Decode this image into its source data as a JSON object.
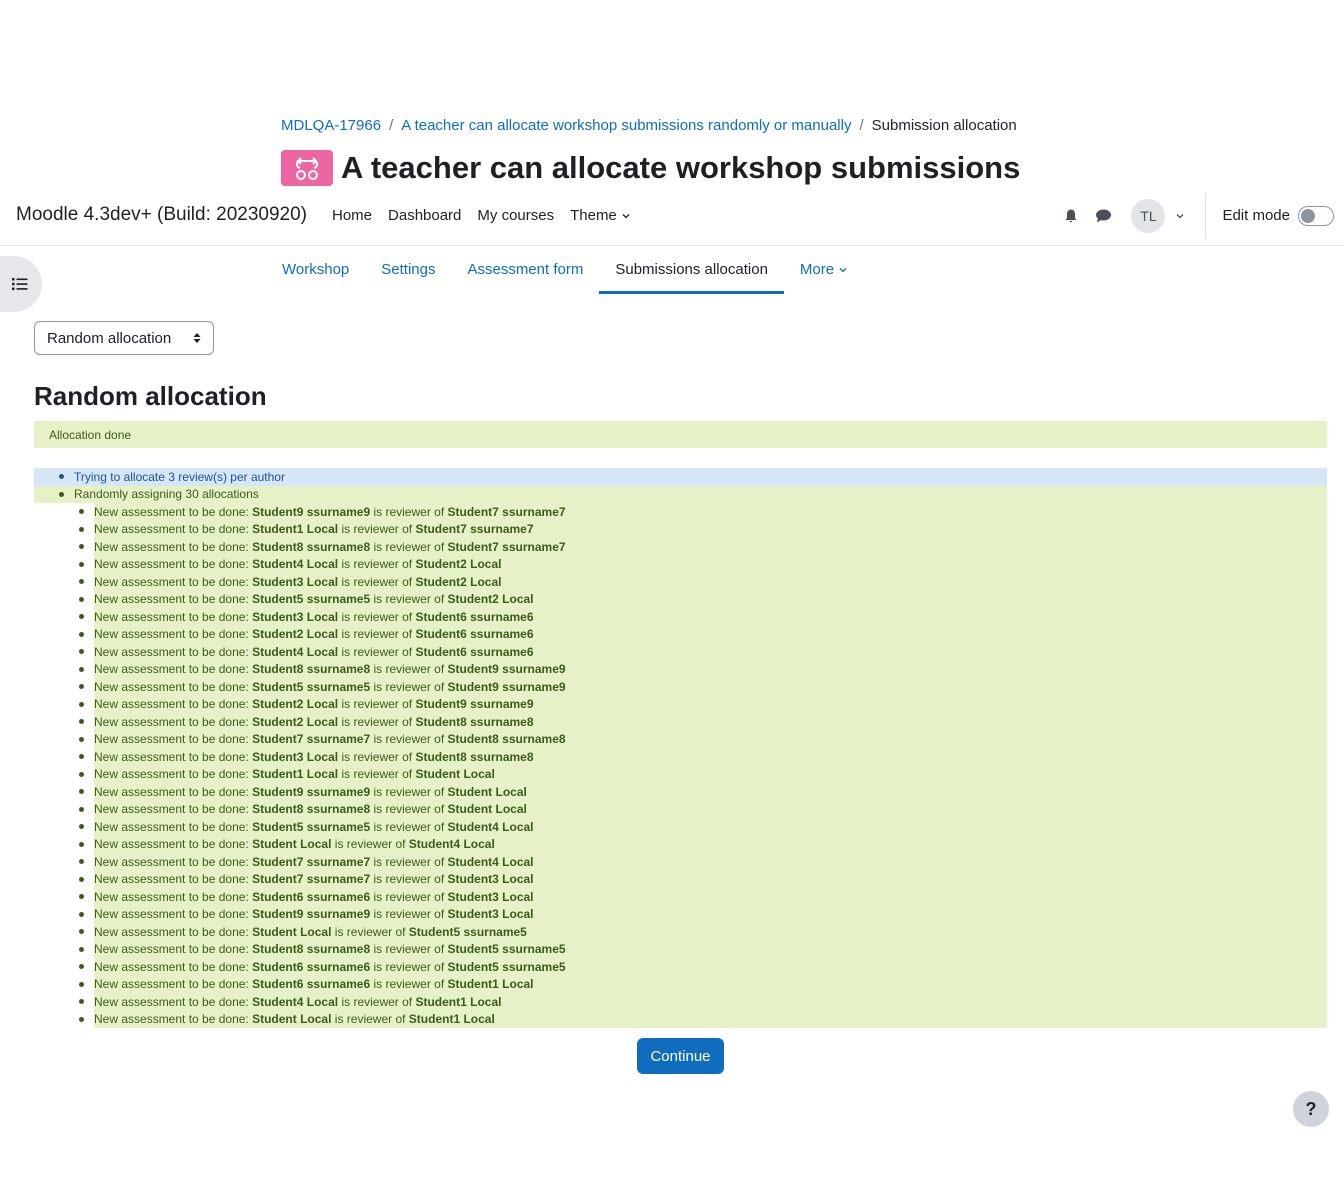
{
  "breadcrumb": [
    {
      "label": "MDLQA-17966"
    },
    {
      "label": "A teacher can allocate workshop submissions randomly or manually"
    },
    {
      "label": "Submission allocation"
    }
  ],
  "page_title": "A teacher can allocate workshop submissions",
  "navbar": {
    "brand": "Moodle 4.3dev+ (Build: 20230920)",
    "items": [
      "Home",
      "Dashboard",
      "My courses",
      "Theme"
    ],
    "avatar_initials": "TL",
    "edit_mode_label": "Edit mode",
    "edit_mode_on": false
  },
  "secondary_nav": {
    "tabs": [
      "Workshop",
      "Settings",
      "Assessment form",
      "Submissions allocation",
      "More"
    ],
    "active": "Submissions allocation"
  },
  "allocator_select": {
    "value": "Random allocation"
  },
  "section_title": "Random allocation",
  "alert": "Allocation done",
  "result": {
    "info_line": "Trying to allocate 3 review(s) per author",
    "assign_line": "Randomly assigning 30 allocations",
    "prefix": "New assessment to be done: ",
    "mid": " is reviewer of ",
    "allocations": [
      {
        "reviewer": "Student9 ssurname9",
        "author": "Student7 ssurname7"
      },
      {
        "reviewer": "Student1 Local",
        "author": "Student7 ssurname7"
      },
      {
        "reviewer": "Student8 ssurname8",
        "author": "Student7 ssurname7"
      },
      {
        "reviewer": "Student4 Local",
        "author": "Student2 Local"
      },
      {
        "reviewer": "Student3 Local",
        "author": "Student2 Local"
      },
      {
        "reviewer": "Student5 ssurname5",
        "author": "Student2 Local"
      },
      {
        "reviewer": "Student3 Local",
        "author": "Student6 ssurname6"
      },
      {
        "reviewer": "Student2 Local",
        "author": "Student6 ssurname6"
      },
      {
        "reviewer": "Student4 Local",
        "author": "Student6 ssurname6"
      },
      {
        "reviewer": "Student8 ssurname8",
        "author": "Student9 ssurname9"
      },
      {
        "reviewer": "Student5 ssurname5",
        "author": "Student9 ssurname9"
      },
      {
        "reviewer": "Student2 Local",
        "author": "Student9 ssurname9"
      },
      {
        "reviewer": "Student2 Local",
        "author": "Student8 ssurname8"
      },
      {
        "reviewer": "Student7 ssurname7",
        "author": "Student8 ssurname8"
      },
      {
        "reviewer": "Student3 Local",
        "author": "Student8 ssurname8"
      },
      {
        "reviewer": "Student1 Local",
        "author": "Student Local"
      },
      {
        "reviewer": "Student9 ssurname9",
        "author": "Student Local"
      },
      {
        "reviewer": "Student8 ssurname8",
        "author": "Student Local"
      },
      {
        "reviewer": "Student5 ssurname5",
        "author": "Student4 Local"
      },
      {
        "reviewer": "Student Local",
        "author": "Student4 Local"
      },
      {
        "reviewer": "Student7 ssurname7",
        "author": "Student4 Local"
      },
      {
        "reviewer": "Student7 ssurname7",
        "author": "Student3 Local"
      },
      {
        "reviewer": "Student6 ssurname6",
        "author": "Student3 Local"
      },
      {
        "reviewer": "Student9 ssurname9",
        "author": "Student3 Local"
      },
      {
        "reviewer": "Student Local",
        "author": "Student5 ssurname5"
      },
      {
        "reviewer": "Student8 ssurname8",
        "author": "Student5 ssurname5"
      },
      {
        "reviewer": "Student6 ssurname6",
        "author": "Student5 ssurname5"
      },
      {
        "reviewer": "Student6 ssurname6",
        "author": "Student1 Local"
      },
      {
        "reviewer": "Student4 Local",
        "author": "Student1 Local"
      },
      {
        "reviewer": "Student Local",
        "author": "Student1 Local"
      }
    ]
  },
  "continue_label": "Continue",
  "help_label": "?",
  "icons": {
    "activity": "workshop-icon",
    "bell": "bell-icon",
    "chat": "chat-icon",
    "drawer": "list-icon",
    "help": "question-icon"
  },
  "colors": {
    "accent": "#0f6cbf",
    "success_bg": "#e7f1c7",
    "success_text": "#3d5a1a",
    "info_bg": "#d5e6f7",
    "activity_icon_bg": "#eb66a2"
  }
}
